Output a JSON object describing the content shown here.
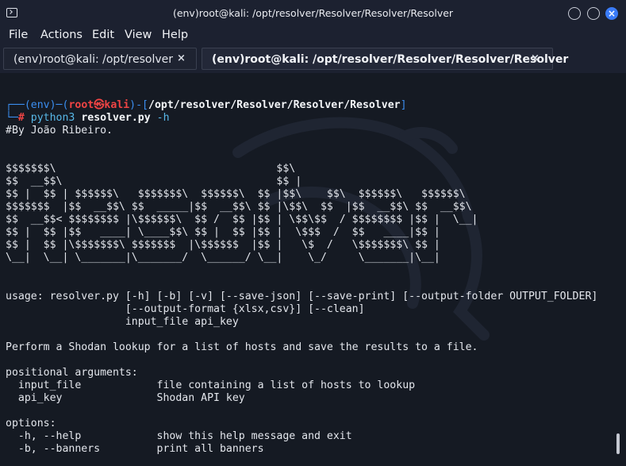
{
  "window": {
    "title": "(env)root@kali: /opt/resolver/Resolver/Resolver/Resolver"
  },
  "menu": [
    "File",
    "Actions",
    "Edit",
    "View",
    "Help"
  ],
  "tabs": [
    {
      "label": "(env)root@kali: /opt/resolver",
      "close": "×"
    },
    {
      "label": "(env)root@kali: /opt/resolver/Resolver/Resolver/Resolver",
      "close": "×"
    }
  ],
  "prompt": {
    "corner_top": "┌──",
    "env": "(env)",
    "dash": "─",
    "open_paren": "(",
    "user": "root",
    "skull": "㉿",
    "host": "kali",
    "close_paren": ")",
    "path_open": "-[",
    "path": "/opt/resolver/Resolver/Resolver/Resolver",
    "path_close": "]",
    "corner_bottom": "└─",
    "hash": "#",
    "cmd": "python3",
    "cmd_arg": "resolver.py",
    "cmd_flag": "-h"
  },
  "output": {
    "author": "#By João Ribeiro.",
    "banner": [
      "$$$$$$$\\                                   $$\\",
      "$$  __$$\\                                  $$ |",
      "$$ |  $$ | $$$$$$\\   $$$$$$$\\  $$$$$$\\  $$ |$$\\    $$\\  $$$$$$\\   $$$$$$\\",
      "$$$$$$$  |$$  __$$\\ $$  _____|$$  __$$\\ $$ |\\$$\\  $$  |$$  __$$\\ $$  __$$\\",
      "$$  __$$< $$$$$$$$ |\\$$$$$$\\  $$ /  $$ |$$ | \\$$\\$$  / $$$$$$$$ |$$ |  \\__|",
      "$$ |  $$ |$$   ____| \\____$$\\ $$ |  $$ |$$ |  \\$$$  /  $$   ____|$$ |",
      "$$ |  $$ |\\$$$$$$$\\ $$$$$$$  |\\$$$$$$  |$$ |   \\$  /   \\$$$$$$$\\ $$ |",
      "\\__|  \\__| \\_______|\\_______/  \\______/ \\__|    \\_/     \\_______|\\__|"
    ],
    "usage_1": "usage: resolver.py [-h] [-b] [-v] [--save-json] [--save-print] [--output-folder OUTPUT_FOLDER]",
    "usage_2": "                   [--output-format {xlsx,csv}] [--clean]",
    "usage_3": "                   input_file api_key",
    "description": "Perform a Shodan lookup for a list of hosts and save the results to a file.",
    "positional_header": "positional arguments:",
    "pos_1": "  input_file            file containing a list of hosts to lookup",
    "pos_2": "  api_key               Shodan API key",
    "options_header": "options:",
    "opt_1": "  -h, --help            show this help message and exit",
    "opt_2": "  -b, --banners         print all banners"
  },
  "colors": {
    "terminal_bg": "#151a23",
    "prompt_blue": "#3b8ef0",
    "prompt_red": "#f04444",
    "accent_close": "#3a7bf7"
  },
  "icons": {
    "app": "terminal-icon",
    "minimize": "minimize-icon",
    "maximize": "maximize-icon",
    "close": "close-icon",
    "background": "kali-dragon-icon"
  }
}
